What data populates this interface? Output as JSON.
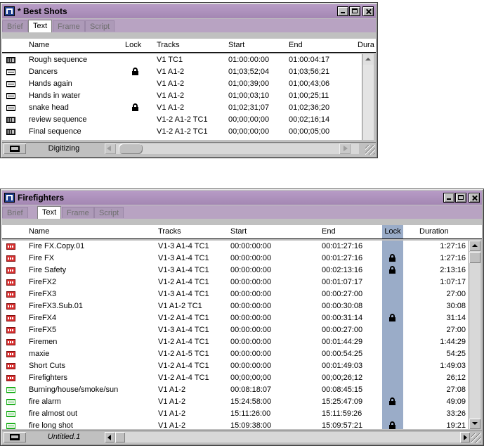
{
  "bin1": {
    "title": "* Best Shots",
    "tabs": [
      "Brief",
      "Text",
      "Frame",
      "Script"
    ],
    "active_tab": "Text",
    "columns": {
      "name": "Name",
      "lock": "Lock",
      "tracks": "Tracks",
      "start": "Start",
      "end": "End",
      "duration": "Dura"
    },
    "rows": [
      {
        "icon": "sequence-icon",
        "name": "Rough sequence",
        "locked": false,
        "tracks": "V1 TC1",
        "start": "01:00:00:00",
        "end": "01:00:04:17"
      },
      {
        "icon": "master-clip-icon",
        "name": "Dancers",
        "locked": true,
        "tracks": "V1 A1-2",
        "start": "01;03;52;04",
        "end": "01;03;56;21"
      },
      {
        "icon": "master-clip-icon",
        "name": "Hands again",
        "locked": false,
        "tracks": "V1 A1-2",
        "start": "01;00;39;00",
        "end": "01;00;43;06"
      },
      {
        "icon": "master-clip-icon",
        "name": "Hands in water",
        "locked": false,
        "tracks": "V1 A1-2",
        "start": "01;00;03;10",
        "end": "01;00;25;11"
      },
      {
        "icon": "master-clip-icon",
        "name": "snake head",
        "locked": true,
        "tracks": "V1 A1-2",
        "start": "01;02;31;07",
        "end": "01;02;36;20"
      },
      {
        "icon": "sequence-icon",
        "name": "review sequence",
        "locked": false,
        "tracks": "V1-2 A1-2 TC1",
        "start": "00;00;00;00",
        "end": "00;02;16;14"
      },
      {
        "icon": "sequence-icon",
        "name": "Final sequence",
        "locked": false,
        "tracks": "V1-2 A1-2 TC1",
        "start": "00;00;00;00",
        "end": "00;00;05;00"
      }
    ],
    "status": "Digitizing"
  },
  "bin2": {
    "title": "Firefighters",
    "tabs": [
      "Brief",
      "Text",
      "Frame",
      "Script"
    ],
    "active_tab": "Text",
    "columns": {
      "name": "Name",
      "tracks": "Tracks",
      "start": "Start",
      "end": "End",
      "lock": "Lock",
      "duration": "Duration"
    },
    "rows": [
      {
        "icon": "sequence-icon",
        "name": "Fire FX.Copy.01",
        "tracks": "V1-3 A1-4 TC1",
        "start": "00:00:00:00",
        "end": "00:01:27:16",
        "locked": false,
        "duration": "1:27:16"
      },
      {
        "icon": "sequence-icon",
        "name": "Fire FX",
        "tracks": "V1-3 A1-4 TC1",
        "start": "00:00:00:00",
        "end": "00:01:27:16",
        "locked": true,
        "duration": "1:27:16"
      },
      {
        "icon": "sequence-icon",
        "name": "Fire Safety",
        "tracks": "V1-3 A1-4 TC1",
        "start": "00:00:00:00",
        "end": "00:02:13:16",
        "locked": true,
        "duration": "2:13:16"
      },
      {
        "icon": "sequence-icon",
        "name": "FireFX2",
        "tracks": "V1-2 A1-4 TC1",
        "start": "00:00:00:00",
        "end": "00:01:07:17",
        "locked": false,
        "duration": "1:07:17"
      },
      {
        "icon": "sequence-icon",
        "name": "FireFX3",
        "tracks": "V1-3 A1-4 TC1",
        "start": "00:00:00:00",
        "end": "00:00:27:00",
        "locked": false,
        "duration": "27:00"
      },
      {
        "icon": "sequence-icon",
        "name": "FireFX3.Sub.01",
        "tracks": "V1 A1-2 TC1",
        "start": "00:00:00:00",
        "end": "00:00:30:08",
        "locked": false,
        "duration": "30:08"
      },
      {
        "icon": "sequence-icon",
        "name": "FireFX4",
        "tracks": "V1-2 A1-4 TC1",
        "start": "00:00:00:00",
        "end": "00:00:31:14",
        "locked": true,
        "duration": "31:14"
      },
      {
        "icon": "sequence-icon",
        "name": "FireFX5",
        "tracks": "V1-3 A1-4 TC1",
        "start": "00:00:00:00",
        "end": "00:00:27:00",
        "locked": false,
        "duration": "27:00"
      },
      {
        "icon": "sequence-icon",
        "name": "Firemen",
        "tracks": "V1-2 A1-4 TC1",
        "start": "00:00:00:00",
        "end": "00:01:44:29",
        "locked": false,
        "duration": "1:44:29"
      },
      {
        "icon": "sequence-icon",
        "name": "maxie",
        "tracks": "V1-2 A1-5 TC1",
        "start": "00:00:00:00",
        "end": "00:00:54:25",
        "locked": false,
        "duration": "54:25"
      },
      {
        "icon": "sequence-icon",
        "name": "Short Cuts",
        "tracks": "V1-2 A1-4 TC1",
        "start": "00:00:00:00",
        "end": "00:01:49:03",
        "locked": false,
        "duration": "1:49:03"
      },
      {
        "icon": "sequence-icon",
        "name": "Firefighters",
        "tracks": "V1-2 A1-4 TC1",
        "start": "00;00;00;00",
        "end": "00;00;26;12",
        "locked": false,
        "duration": "26;12"
      },
      {
        "icon": "master-clip-icon",
        "name": "Burning/house/smoke/sun",
        "tracks": "V1 A1-2",
        "start": "00:08:18:07",
        "end": "00:08:45:15",
        "locked": false,
        "duration": "27:08"
      },
      {
        "icon": "master-clip-icon",
        "name": "fire alarm",
        "tracks": "V1 A1-2",
        "start": "15:24:58:00",
        "end": "15:25:47:09",
        "locked": true,
        "duration": "49:09"
      },
      {
        "icon": "master-clip-icon",
        "name": "fire almost out",
        "tracks": "V1 A1-2",
        "start": "15:11:26:00",
        "end": "15:11:59:26",
        "locked": false,
        "duration": "33:26"
      },
      {
        "icon": "master-clip-icon",
        "name": "fire long shot",
        "tracks": "V1 A1-2",
        "start": "15:09:38:00",
        "end": "15:09:57:21",
        "locked": true,
        "duration": "19:21"
      }
    ],
    "status": "Untitled.1"
  }
}
